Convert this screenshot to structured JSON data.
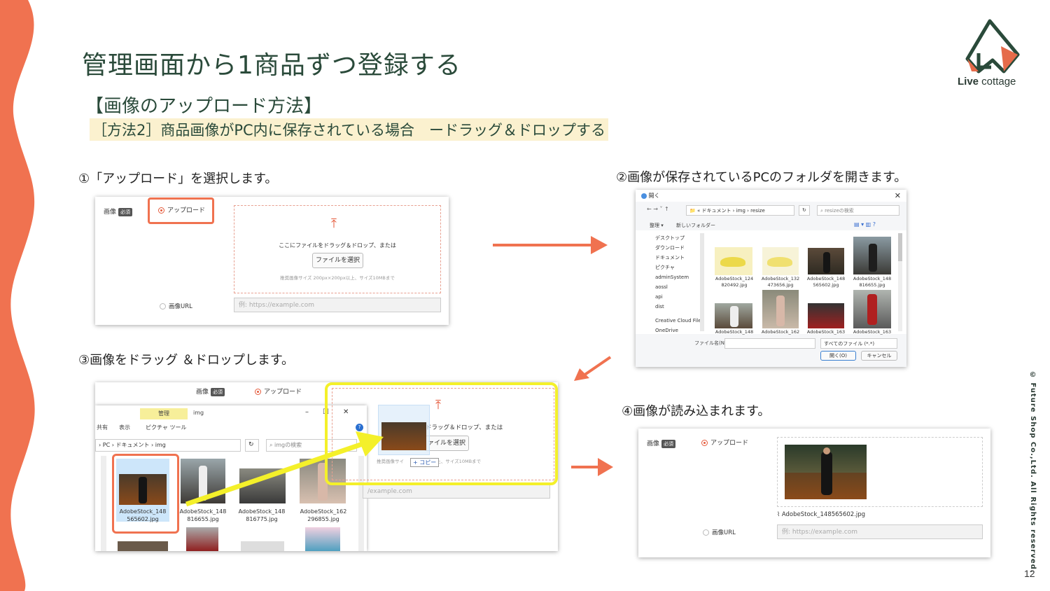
{
  "title": "管理画面から1商品ずつ登録する",
  "subtitle": "【画像のアップロード方法】",
  "method": "［方法2］商品画像がPC内に保存されている場合　ードラッグ＆ドロップする",
  "logo": {
    "text_bold": "Live",
    "text_rest": " cottage"
  },
  "copyright": "© Future Shop Co.,Ltd. All Rights reserved.",
  "page_number": "12",
  "steps": [
    "①「アップロード」を選択します。",
    "②画像が保存されているPCのフォルダを開きます。",
    "③画像をドラッグ ＆ドロップします。",
    "④画像が読み込まれます。"
  ],
  "form": {
    "image_label": "画像",
    "required": "必須",
    "upload_option": "アップロード",
    "drop_text": "ここにファイルをドラッグ＆ドロップ、または",
    "select_file": "ファイルを選択",
    "recommend": "推奨画像サイズ 200px×200px以上、サイズ10MBまで",
    "url_option": "画像URL",
    "url_placeholder": "例: https://example.com"
  },
  "dialog": {
    "title": "開く",
    "path": "« ドキュメント › img › resize",
    "search": "resizeの検索",
    "organize": "整理 ▾",
    "new_folder": "新しいフォルダー",
    "sidebar": [
      "デスクトップ",
      "ダウンロード",
      "ドキュメント",
      "ピクチャ",
      "adminSystem",
      "aossl",
      "api",
      "dist",
      "Creative Cloud File",
      "OneDrive"
    ],
    "files": [
      "AdobeStock_124\n820492.jpg",
      "AdobeStock_132\n473656.jpg",
      "AdobeStock_148\n565602.jpg",
      "AdobeStock_148\n816655.jpg",
      "AdobeStock_148",
      "AdobeStock_162",
      "AdobeStock_163",
      "AdobeStock_163"
    ],
    "filename_label": "ファイル名(N):",
    "filter": "すべてのファイル (*.*)",
    "open_btn": "開く(O)",
    "cancel_btn": "キャンセル"
  },
  "explorer": {
    "manage_tab": "管理",
    "folder": "img",
    "share": "共有",
    "view": "表示",
    "picture_tools": "ピクチャ ツール",
    "path": "PC › ドキュメント › img",
    "search": "imgの検索",
    "files": [
      "AdobeStock_148\n565602.jpg",
      "AdobeStock_148\n816655.jpg",
      "AdobeStock_148\n816775.jpg",
      "AdobeStock_162\n296855.jpg"
    ],
    "copy_badge": "+ コピー",
    "url_partial": "/example.com"
  },
  "result": {
    "filename": "AdobeStock_148565602.jpg"
  }
}
